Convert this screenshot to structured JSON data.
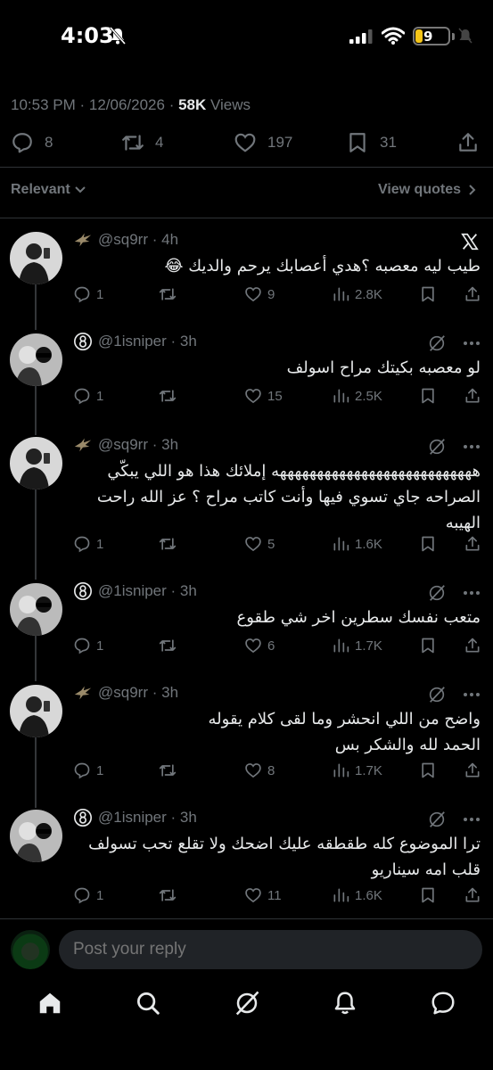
{
  "status_bar": {
    "time": "4:03",
    "battery": "9"
  },
  "tweet_meta": {
    "time": "10:53 PM",
    "sep1": " · ",
    "date": "12/06/2026",
    "sep2": " · ",
    "views_count": "58K",
    "views_label": " Views"
  },
  "tweet_actions": {
    "replies": "8",
    "reposts": "4",
    "likes": "197",
    "bookmarks": "31"
  },
  "filters": {
    "sort": "Relevant",
    "view_quotes": "View quotes"
  },
  "replies": [
    {
      "handle": "@sq9rr",
      "time": "4h",
      "text": "طيب ليه معصبه ؟هدي أعصابك يرحم والديك 😂",
      "replies": "1",
      "reposts": "",
      "likes": "9",
      "views": "2.8K"
    },
    {
      "handle": "@1isniper",
      "time": "3h",
      "text": "لو معصبه بكيتك مراح اسولف",
      "replies": "1",
      "reposts": "",
      "likes": "15",
      "views": "2.5K"
    },
    {
      "handle": "@sq9rr",
      "time": "3h",
      "text": "هههههههههههههههههههههههههههه إملائك هذا هو اللي يبكّي الصراحه جاي تسوي فيها وأنت كاتب مراح ؟ عز الله راحت الهيبه",
      "replies": "1",
      "reposts": "",
      "likes": "5",
      "views": "1.6K"
    },
    {
      "handle": "@1isniper",
      "time": "3h",
      "text": "متعب نفسك سطرين اخر شي طقوع",
      "replies": "1",
      "reposts": "",
      "likes": "6",
      "views": "1.7K"
    },
    {
      "handle": "@sq9rr",
      "time": "3h",
      "text": "واضح من اللي انحشر وما لقى كلام يقوله الحمد لله والشكر بس",
      "replies": "1",
      "reposts": "",
      "likes": "8",
      "views": "1.7K"
    },
    {
      "handle": "@1isniper",
      "time": "3h",
      "text": "ترا الموضوع كله طقطقه عليك اضحك ولا تقلع تحب تسولف قلب امه سيناريو",
      "replies": "1",
      "reposts": "",
      "likes": "11",
      "views": "1.6K"
    }
  ],
  "reply_bar": {
    "placeholder": "Post your reply"
  },
  "colors": {
    "background": "#000000",
    "text": "#e7e9ea",
    "muted": "#71767b",
    "divider": "#2f3336",
    "battery": "#f5c518"
  },
  "icons": [
    "bell-off-icon",
    "signal-icon",
    "wifi-icon",
    "battery-icon",
    "reply-icon",
    "repost-icon",
    "like-icon",
    "bookmark-icon",
    "share-icon",
    "views-icon",
    "grok-icon",
    "more-icon",
    "x-logo-icon",
    "home-icon",
    "search-icon",
    "notifications-icon",
    "messages-icon"
  ]
}
